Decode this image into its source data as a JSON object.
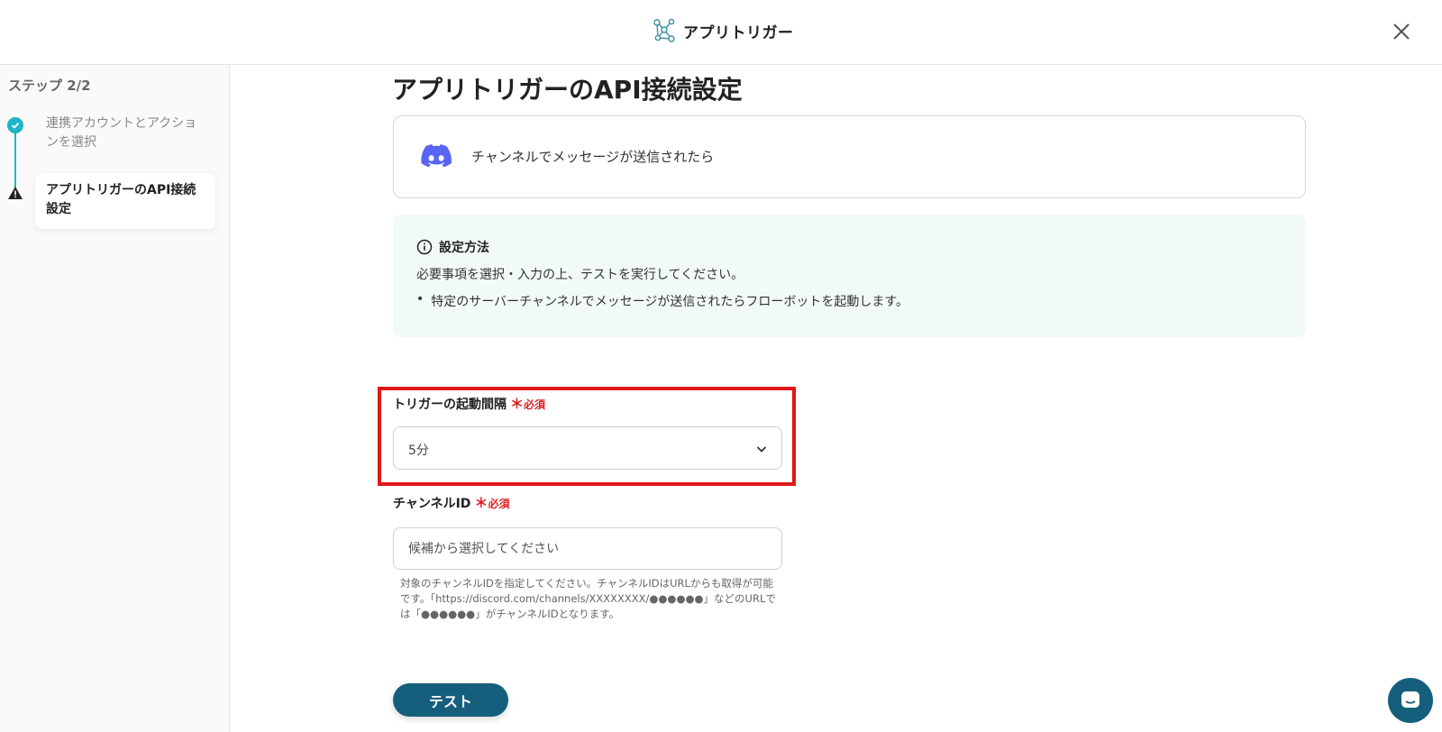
{
  "header": {
    "title": "アプリトリガー",
    "logo_icon": "network-nodes-icon",
    "close_icon": "close-icon"
  },
  "sidebar": {
    "step_title": "ステップ 2/2",
    "steps": [
      {
        "label": "連携アカウントとアクションを選択",
        "status": "complete",
        "icon": "check-circle-icon"
      },
      {
        "label": "アプリトリガーのAPI接続設定",
        "status": "warning",
        "icon": "warning-icon"
      }
    ],
    "accent_color": "#1fb5c9"
  },
  "main": {
    "page_title": "アプリトリガーのAPI接続設定",
    "event": {
      "icon": "discord-icon",
      "text": "チャンネルでメッセージが送信されたら"
    },
    "info": {
      "title": "設定方法",
      "description": "必要事項を選択・入力の上、テストを実行してください。",
      "bullets": [
        "特定のサーバーチャンネルでメッセージが送信されたらフローボットを起動します。"
      ]
    },
    "fields": {
      "interval": {
        "label": "トリガーの起動間隔",
        "required_mark": "＊",
        "required_text": "必須",
        "value": "5分"
      },
      "channel": {
        "label": "チャンネルID",
        "required_mark": "＊",
        "required_text": "必須",
        "placeholder": "候補から選択してください",
        "help": "対象のチャンネルIDを指定してください。チャンネルIDはURLからも取得が可能です。「https://discord.com/channels/XXXXXXXX/●●●●●●」などのURLでは「●●●●●●」がチャンネルIDとなります。"
      }
    },
    "test_button": "テスト"
  },
  "colors": {
    "primary": "#155f7d",
    "required": "#e02020",
    "highlight": "#e01818",
    "info_bg": "#f2faf8",
    "discord": "#5865f2"
  },
  "chat_icon": "chat-bubble-icon"
}
